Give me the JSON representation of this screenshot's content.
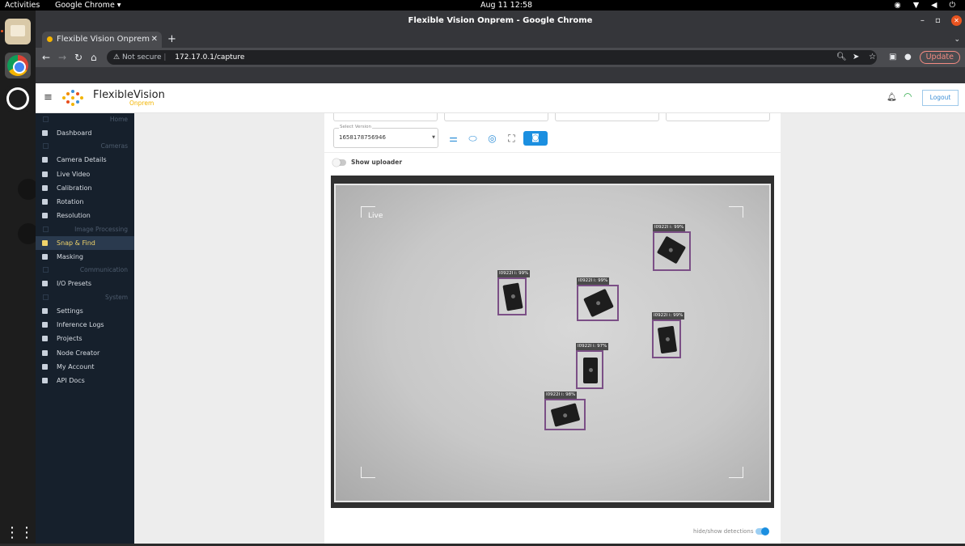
{
  "desktop": {
    "activities": "Activities",
    "app_menu": "Google Chrome ▾",
    "clock": "Aug 11  12:58",
    "tray_icons": [
      "chrome-icon",
      "wifi-icon",
      "volume-icon",
      "power-icon"
    ]
  },
  "browser": {
    "window_title": "Flexible Vision Onprem - Google Chrome",
    "tab_title": "Flexible Vision Onprem",
    "security_label": "Not secure",
    "url": "172.17.0.1/capture",
    "update_label": "Update"
  },
  "app": {
    "brand": "FlexibleVision",
    "brand_sub": "Onprem",
    "logout": "Logout",
    "sidebar": [
      {
        "type": "section",
        "label": "Home"
      },
      {
        "type": "item",
        "label": "Dashboard",
        "icon": "dashboard-icon"
      },
      {
        "type": "section",
        "label": "Cameras"
      },
      {
        "type": "item",
        "label": "Camera Details",
        "icon": "camera-icon"
      },
      {
        "type": "item",
        "label": "Live Video",
        "icon": "video-icon"
      },
      {
        "type": "item",
        "label": "Calibration",
        "icon": "crosshair-icon"
      },
      {
        "type": "item",
        "label": "Rotation",
        "icon": "rotate-icon"
      },
      {
        "type": "item",
        "label": "Resolution",
        "icon": "monitor-icon"
      },
      {
        "type": "section",
        "label": "Image Processing"
      },
      {
        "type": "item",
        "label": "Snap & Find",
        "icon": "snap-icon",
        "active": true
      },
      {
        "type": "item",
        "label": "Masking",
        "icon": "mask-icon"
      },
      {
        "type": "section",
        "label": "Communication"
      },
      {
        "type": "item",
        "label": "I/O Presets",
        "icon": "plug-icon"
      },
      {
        "type": "section",
        "label": "System"
      },
      {
        "type": "item",
        "label": "Settings",
        "icon": "gear-icon"
      },
      {
        "type": "item",
        "label": "Inference Logs",
        "icon": "log-icon"
      },
      {
        "type": "item",
        "label": "Projects",
        "icon": "list-icon"
      },
      {
        "type": "item",
        "label": "Node Creator",
        "icon": "node-icon"
      },
      {
        "type": "item",
        "label": "My Account",
        "icon": "cloud-icon"
      },
      {
        "type": "item",
        "label": "API Docs",
        "icon": "doc-icon"
      }
    ],
    "capture": {
      "select_version_label": "Select Version",
      "select_version_value": "1658178756946",
      "tools": [
        "sliders-icon",
        "aperture-icon",
        "focus-icon",
        "scan-icon",
        "camera-icon"
      ],
      "show_uploader": "Show uploader",
      "live_label": "Live",
      "detections": [
        {
          "label": "I0922I i: 99%"
        },
        {
          "label": "I0922I i: 99%"
        },
        {
          "label": "I0922I i: 99%"
        },
        {
          "label": "I0922I i: 99%"
        },
        {
          "label": "I0922I i: 97%"
        },
        {
          "label": "I0922I i: 98%"
        }
      ],
      "hide_show_label": "hide/show detections",
      "hide_show_on": true
    }
  }
}
